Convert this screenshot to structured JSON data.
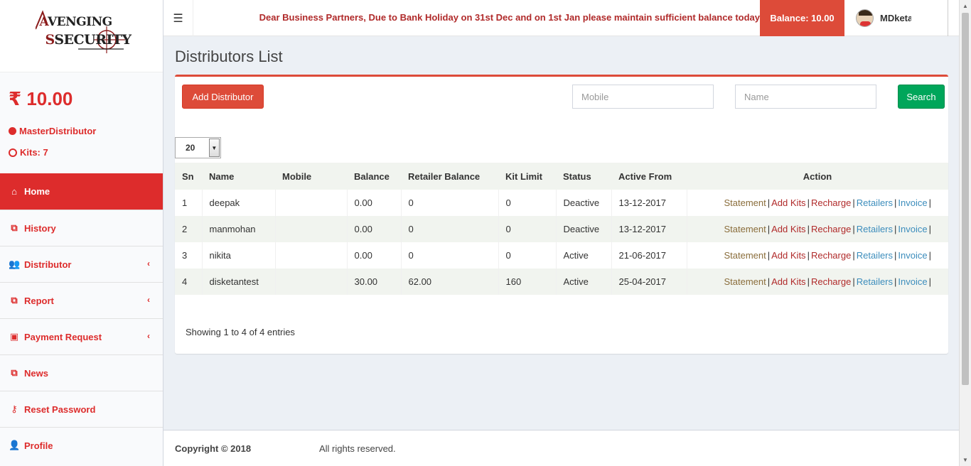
{
  "brand": {
    "line1": "VENGING",
    "line2": "SECURITY",
    "initial1": "A",
    "initial2": "S"
  },
  "sidebar": {
    "balance": "₹ 10.00",
    "role": "MasterDistributor",
    "kits": "Kits: 7",
    "items": [
      {
        "label": "Home",
        "icon": "home-icon"
      },
      {
        "label": "History",
        "icon": "copy-icon"
      },
      {
        "label": "Distributor",
        "icon": "users-icon"
      },
      {
        "label": "Report",
        "icon": "copy-icon"
      },
      {
        "label": "Payment Request",
        "icon": "money-icon"
      },
      {
        "label": "News",
        "icon": "copy-icon"
      },
      {
        "label": "Reset Password",
        "icon": "key-icon"
      },
      {
        "label": "Profile",
        "icon": "user-icon"
      }
    ]
  },
  "header": {
    "marquee": "Dear Business Partners, Due to Bank Holiday on 31st Dec and on 1st Jan please maintain sufficient balance today",
    "balance": "Balance: 10.00",
    "username": "MDketan"
  },
  "main": {
    "title": "Distributors List",
    "add_label": "Add Distributor",
    "mobile_placeholder": "Mobile",
    "name_placeholder": "Name",
    "search_label": "Search",
    "page_length": "20",
    "columns": [
      "Sn",
      "Name",
      "Mobile",
      "Balance",
      "Retailer Balance",
      "Kit Limit",
      "Status",
      "Active From",
      "Action"
    ],
    "rows": [
      {
        "sn": "1",
        "name": "deepak",
        "mobile": "",
        "balance": "0.00",
        "retailer_balance": "0",
        "kit_limit": "0",
        "status": "Deactive",
        "active_from": "13-12-2017"
      },
      {
        "sn": "2",
        "name": "manmohan",
        "mobile": "",
        "balance": "0.00",
        "retailer_balance": "0",
        "kit_limit": "0",
        "status": "Deactive",
        "active_from": "13-12-2017"
      },
      {
        "sn": "3",
        "name": "nikita",
        "mobile": "",
        "balance": "0.00",
        "retailer_balance": "0",
        "kit_limit": "0",
        "status": "Active",
        "active_from": "21-06-2017"
      },
      {
        "sn": "4",
        "name": "disketantest",
        "mobile": "",
        "balance": "30.00",
        "retailer_balance": "62.00",
        "kit_limit": "160",
        "status": "Active",
        "active_from": "25-04-2017"
      }
    ],
    "actions": [
      "Statement",
      "Add Kits",
      "Recharge",
      "Retailers",
      "Invoice"
    ],
    "info": "Showing 1 to 4 of 4 entries"
  },
  "footer": {
    "copyright": "Copyright © 2018",
    "rights": "All rights reserved."
  },
  "colors": {
    "accent": "#dd4b39",
    "sidebar_text": "#dd2c2c",
    "success": "#00a65a"
  }
}
